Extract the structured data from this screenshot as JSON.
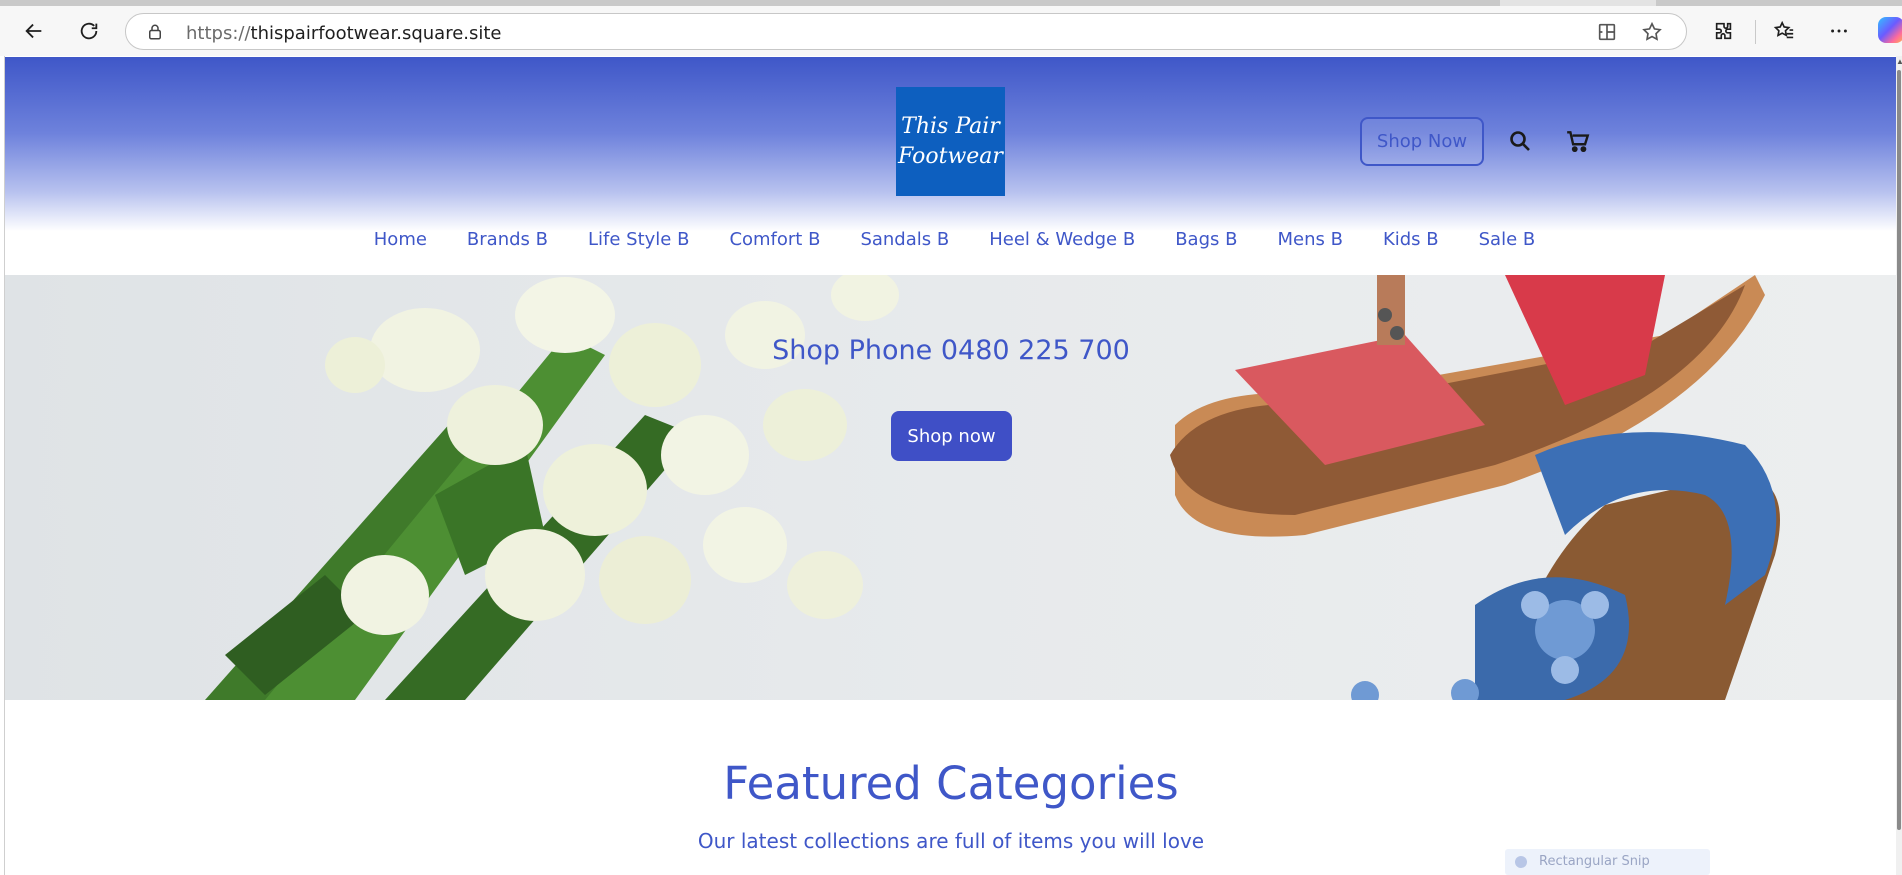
{
  "browser": {
    "url_protocol": "https://",
    "url_host": "thispairfootwear.square.site",
    "icons": {
      "back": "back-arrow-icon",
      "reload": "reload-icon",
      "lock": "lock-icon",
      "app": "app-available-icon",
      "favorite": "star-icon",
      "extensions": "extensions-icon",
      "favorites": "favorites-icon",
      "more": "more-icon",
      "copilot": "copilot-icon"
    }
  },
  "header": {
    "logo_line1": "This Pair",
    "logo_line2": "Footwear",
    "shop_now_label": "Shop Now",
    "nav": [
      "Home",
      "Brands B",
      "Life Style B",
      "Comfort B",
      "Sandals B",
      "Heel & Wedge B",
      "Bags B",
      "Mens B",
      "Kids B",
      "Sale B"
    ]
  },
  "hero": {
    "title": "Shop Phone 0480 225 700",
    "button_label": "Shop now"
  },
  "featured": {
    "title": "Featured Categories",
    "subtitle": "Our latest collections are full of items you will love"
  },
  "overlay": {
    "tooltip_text": "Rectangular Snip"
  },
  "colors": {
    "brand_blue": "#3f57c8",
    "logo_blue": "#0d5fbf",
    "button_blue": "#3f4fc6"
  }
}
